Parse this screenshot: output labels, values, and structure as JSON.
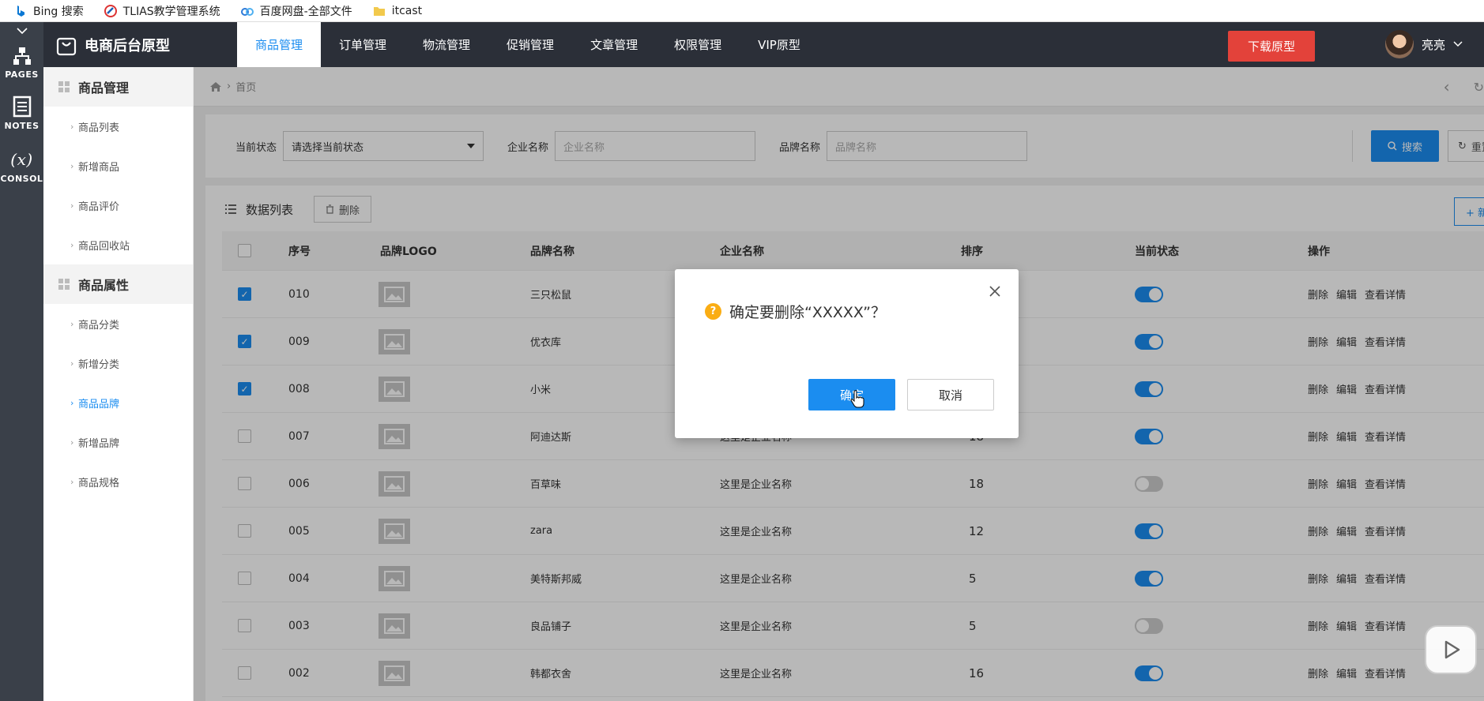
{
  "bookmarks": [
    {
      "label": "Bing 搜索"
    },
    {
      "label": "TLIAS教学管理系统"
    },
    {
      "label": "百度网盘-全部文件"
    },
    {
      "label": "itcast"
    }
  ],
  "rail": {
    "items": [
      {
        "label": "PAGES"
      },
      {
        "label": "NOTES"
      },
      {
        "label": "CONSOL"
      }
    ]
  },
  "header": {
    "brand": "电商后台原型",
    "nav": [
      {
        "label": "商品管理"
      },
      {
        "label": "订单管理"
      },
      {
        "label": "物流管理"
      },
      {
        "label": "促销管理"
      },
      {
        "label": "文章管理"
      },
      {
        "label": "权限管理"
      },
      {
        "label": "VIP原型"
      }
    ],
    "download": "下载原型",
    "user": "亮亮",
    "accent": "#1b8df0",
    "danger": "#e3423a"
  },
  "sidebar": {
    "groups": [
      {
        "title": "商品管理",
        "items": [
          "商品列表",
          "新增商品",
          "商品评价",
          "商品回收站"
        ]
      },
      {
        "title": "商品属性",
        "items": [
          "商品分类",
          "新增分类",
          "商品品牌",
          "新增品牌",
          "商品规格"
        ]
      }
    ],
    "active": "商品品牌"
  },
  "breadcrumb": {
    "home": "首页"
  },
  "filter": {
    "status_label": "当前状态",
    "status_value": "请选择当前状态",
    "company_label": "企业名称",
    "company_placeholder": "企业名称",
    "brand_label": "品牌名称",
    "brand_placeholder": "品牌名称",
    "search": "搜索",
    "reset": "重置"
  },
  "list": {
    "title": "数据列表",
    "delete": "删除",
    "new": "+ 新增",
    "columns": [
      "序号",
      "品牌LOGO",
      "品牌名称",
      "企业名称",
      "排序",
      "当前状态",
      "操作"
    ],
    "ops": [
      "删除",
      "编辑",
      "查看详情"
    ],
    "rows": [
      {
        "id": "010",
        "name": "三只松鼠",
        "company": "",
        "sort": "",
        "checked": true,
        "on": true
      },
      {
        "id": "009",
        "name": "优衣库",
        "company": "",
        "sort": "",
        "checked": true,
        "on": true
      },
      {
        "id": "008",
        "name": "小米",
        "company": "",
        "sort": "",
        "checked": true,
        "on": true
      },
      {
        "id": "007",
        "name": "阿迪达斯",
        "company": "这里是企业名称",
        "sort": "18",
        "checked": false,
        "on": true
      },
      {
        "id": "006",
        "name": "百草味",
        "company": "这里是企业名称",
        "sort": "18",
        "checked": false,
        "on": false
      },
      {
        "id": "005",
        "name": "zara",
        "company": "这里是企业名称",
        "sort": "12",
        "checked": false,
        "on": true
      },
      {
        "id": "004",
        "name": "美特斯邦威",
        "company": "这里是企业名称",
        "sort": "5",
        "checked": false,
        "on": true
      },
      {
        "id": "003",
        "name": "良品铺子",
        "company": "这里是企业名称",
        "sort": "5",
        "checked": false,
        "on": false
      },
      {
        "id": "002",
        "name": "韩都衣舍",
        "company": "这里是企业名称",
        "sort": "16",
        "checked": false,
        "on": true
      }
    ]
  },
  "dialog": {
    "message": "确定要删除“XXXXX”？",
    "ok": "确定",
    "cancel": "取消"
  }
}
